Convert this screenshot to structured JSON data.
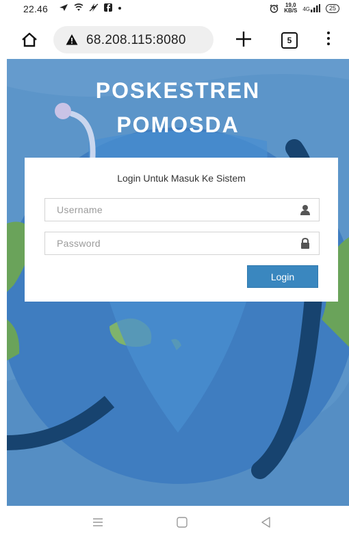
{
  "status_bar": {
    "time": "22.46",
    "net_speed_value": "19,0",
    "net_speed_unit": "KB/S",
    "network_type": "4G",
    "battery_level": "25"
  },
  "browser": {
    "url": "68.208.115:8080",
    "tab_count": "5"
  },
  "site": {
    "title_line1": "POSKESTREN",
    "title_line2": "POMOSDA",
    "login_heading": "Login Untuk Masuk Ke Sistem",
    "username_placeholder": "Username",
    "password_placeholder": "Password",
    "login_label": "Login"
  },
  "icons": {
    "status": [
      "location-arrow-icon",
      "wifi-icon",
      "no-charging-icon",
      "facebook-icon",
      "dot-icon",
      "alarm-icon",
      "signal-icon"
    ],
    "browser": [
      "home-icon",
      "warning-icon",
      "plus-icon",
      "tabs-icon",
      "more-vert-icon"
    ],
    "fields": [
      "user-icon",
      "lock-icon"
    ],
    "nav": [
      "menu-icon",
      "home-square-icon",
      "back-triangle-icon"
    ]
  },
  "colors": {
    "background_blue": "#5c95c9",
    "login_button": "#3a87bf",
    "stethoscope_dark": "#17436f",
    "land_green": "#6aa35a"
  }
}
